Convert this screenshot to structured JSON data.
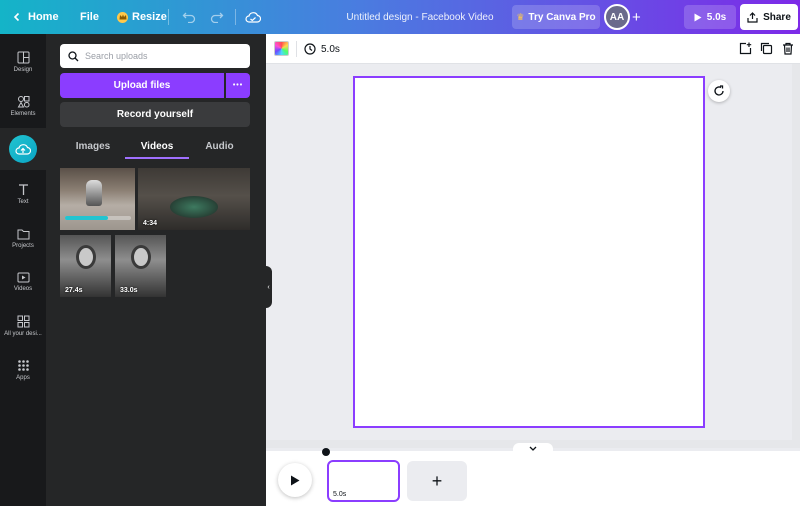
{
  "topbar": {
    "home_label": "Home",
    "file_label": "File",
    "resize_label": "Resize",
    "design_title": "Untitled design - Facebook Video",
    "try_pro_label": "Try Canva Pro",
    "avatar_initials": "AA",
    "play_duration": "5.0s",
    "share_label": "Share"
  },
  "rail": {
    "items": [
      {
        "label": "Design",
        "icon": "layout-icon"
      },
      {
        "label": "Elements",
        "icon": "shapes-icon"
      },
      {
        "label": "",
        "icon": "cloud-upload-icon"
      },
      {
        "label": "Text",
        "icon": "text-icon"
      },
      {
        "label": "Projects",
        "icon": "folder-icon"
      },
      {
        "label": "Videos",
        "icon": "video-icon"
      },
      {
        "label": "All your desi...",
        "icon": "grid-icon"
      },
      {
        "label": "Apps",
        "icon": "apps-icon"
      }
    ]
  },
  "panel": {
    "search_placeholder": "Search uploads",
    "upload_label": "Upload files",
    "more_label": "•••",
    "record_label": "Record yourself",
    "tabs": [
      {
        "label": "Images"
      },
      {
        "label": "Videos"
      },
      {
        "label": "Audio"
      }
    ],
    "videos": [
      {
        "duration": "",
        "progress": 0.65
      },
      {
        "duration": "4:34"
      },
      {
        "duration": "27.4s"
      },
      {
        "duration": "33.0s"
      }
    ]
  },
  "editor": {
    "page_duration": "5.0s",
    "accent_color": "#8b3dff"
  },
  "timeline": {
    "clip_duration": "5.0s",
    "add_label": "+"
  }
}
